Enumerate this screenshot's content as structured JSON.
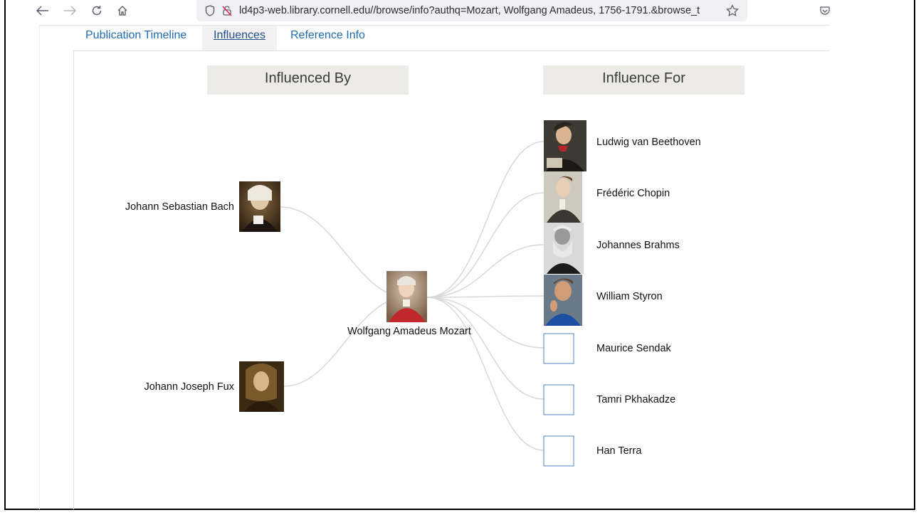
{
  "browser": {
    "url": "ld4p3-web.library.cornell.edu//browse/info?authq=Mozart, Wolfgang Amadeus, 1756-1791.&browse_t",
    "icons": [
      "back-icon",
      "forward-icon",
      "reload-icon",
      "home-icon",
      "shield-icon",
      "lock-broken-icon",
      "bookmark-star-icon",
      "pocket-icon"
    ]
  },
  "tabs": [
    {
      "label": "Publication Timeline"
    },
    {
      "label": "Influences"
    },
    {
      "label": "Reference Info"
    }
  ],
  "active_tab": "Influences",
  "headers": {
    "influenced_by": "Influenced By",
    "influence_for": "Influence For"
  },
  "center": {
    "name": "Wolfgang Amadeus Mozart",
    "image": "portrait"
  },
  "influenced_by": [
    {
      "name": "Johann Sebastian Bach",
      "image": "portrait"
    },
    {
      "name": "Johann Joseph Fux",
      "image": "portrait"
    }
  ],
  "influence_for": [
    {
      "name": "Ludwig van Beethoven",
      "image": "portrait"
    },
    {
      "name": "Frédéric Chopin",
      "image": "portrait"
    },
    {
      "name": "Johannes Brahms",
      "image": "portrait"
    },
    {
      "name": "William Styron",
      "image": "portrait"
    },
    {
      "name": "Maurice Sendak",
      "image": "none"
    },
    {
      "name": "Tamri Pkhakadze",
      "image": "none"
    },
    {
      "name": "Han Terra",
      "image": "none"
    }
  ],
  "colors": {
    "link": "#1f6bb0",
    "link_line": "#d8d8d8",
    "placeholder_border": "#4a86c5",
    "header_bg": "#ecebe7"
  }
}
